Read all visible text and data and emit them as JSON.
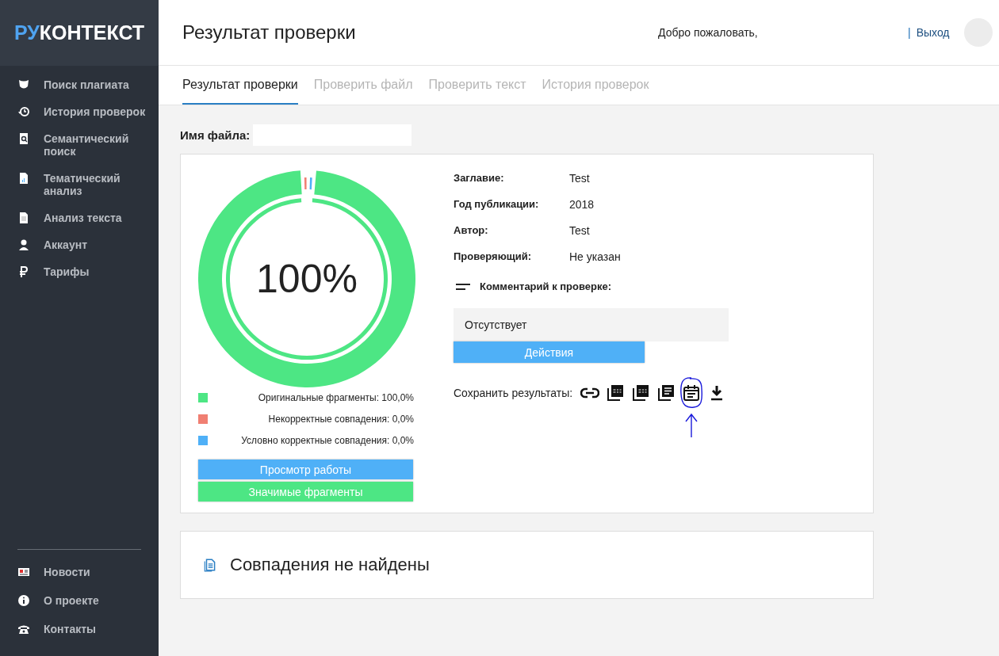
{
  "logo": {
    "accent": "РУ",
    "rest": "КОНТЕКСТ"
  },
  "sidebar": {
    "items": [
      {
        "label": "Поиск плагиата",
        "kind": "shield"
      },
      {
        "label": "История проверок",
        "kind": "history"
      },
      {
        "label": "Семантический поиск",
        "kind": "search-doc"
      },
      {
        "label": "Тематический анализ",
        "kind": "chart-doc"
      },
      {
        "label": "Анализ текста",
        "kind": "doc"
      },
      {
        "label": "Аккаунт",
        "kind": "user"
      },
      {
        "label": "Тарифы",
        "kind": "ruble"
      }
    ],
    "bottom_items": [
      {
        "label": "Новости",
        "kind": "news"
      },
      {
        "label": "О проекте",
        "kind": "info"
      },
      {
        "label": "Контакты",
        "kind": "phone"
      }
    ]
  },
  "header": {
    "title": "Результат проверки",
    "welcome": "Добро пожаловать,",
    "separator": "|",
    "logout": "Выход"
  },
  "tabs": [
    {
      "label": "Результат проверки",
      "selected": true
    },
    {
      "label": "Проверить файл",
      "selected": false
    },
    {
      "label": "Проверить текст",
      "selected": false
    },
    {
      "label": "История проверок",
      "selected": false
    }
  ],
  "file_name": {
    "label": "Имя файла:"
  },
  "result": {
    "percent": "100%",
    "legend": [
      {
        "label": "Оригинальные фрагменты: 100,0%",
        "color": "#4de684"
      },
      {
        "label": "Некорректные совпадения: 0,0%",
        "color": "#f07f72"
      },
      {
        "label": "Условно корректные совпадения: 0,0%",
        "color": "#4fb0f7"
      }
    ],
    "buttons": [
      {
        "label": "Просмотр работы",
        "kind": "primary"
      },
      {
        "label": "Значимые фрагменты",
        "kind": "success"
      }
    ]
  },
  "info": [
    {
      "label": "Заглавие:",
      "value": "Test"
    },
    {
      "label": "Год публикации:",
      "value": "2018"
    },
    {
      "label": "Автор:",
      "value": "Test"
    },
    {
      "label": "Проверяющий:",
      "value": "Не указан"
    }
  ],
  "comment": {
    "title": "Комментарий к проверке:",
    "text": "Отсутствует"
  },
  "actions_button": "Действия",
  "save": {
    "label": "Сохранить результаты:",
    "icons": [
      {
        "kind": "link",
        "annotated": false
      },
      {
        "kind": "pdf",
        "annotated": false
      },
      {
        "kind": "pdf",
        "annotated": false
      },
      {
        "kind": "report",
        "annotated": false
      },
      {
        "kind": "calendar",
        "annotated": true
      },
      {
        "kind": "download",
        "annotated": false
      }
    ]
  },
  "matches": {
    "text": "Совпадения не найдены"
  }
}
